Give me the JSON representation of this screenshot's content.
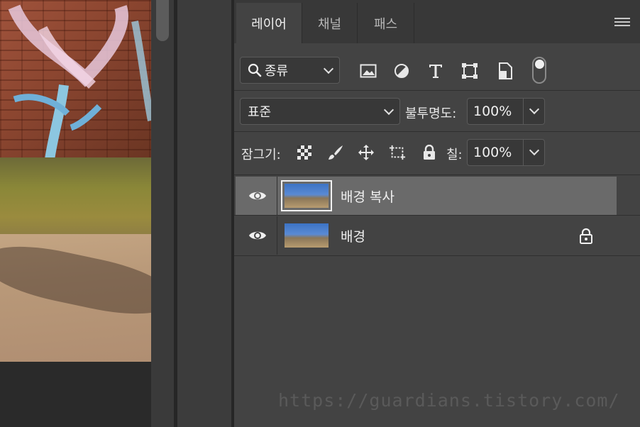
{
  "panel": {
    "tabs": [
      {
        "label": "레이어",
        "active": true
      },
      {
        "label": "채널",
        "active": false
      },
      {
        "label": "패스",
        "active": false
      }
    ],
    "filter": {
      "label": "종류",
      "icons": [
        "image-filter-icon",
        "adjustment-filter-icon",
        "type-filter-icon",
        "shape-filter-icon",
        "smart-object-filter-icon"
      ]
    },
    "blend_mode": "표준",
    "opacity_label": "불투명도:",
    "opacity_value": "100%",
    "lock_label": "잠그기:",
    "lock_icons": [
      "lock-transparent-icon",
      "lock-pixels-icon",
      "lock-position-icon",
      "lock-artboard-icon",
      "lock-all-icon"
    ],
    "fill_label": "칠:",
    "fill_value": "100%",
    "layers": [
      {
        "name": "배경 복사",
        "selected": true,
        "locked": false
      },
      {
        "name": "배경",
        "selected": false,
        "locked": true
      }
    ]
  },
  "watermark": "https://guardians.tistory.com/",
  "colors": {
    "panel_bg": "#434343",
    "selected_row": "#6a6a6a",
    "tab_bar": "#383838"
  }
}
